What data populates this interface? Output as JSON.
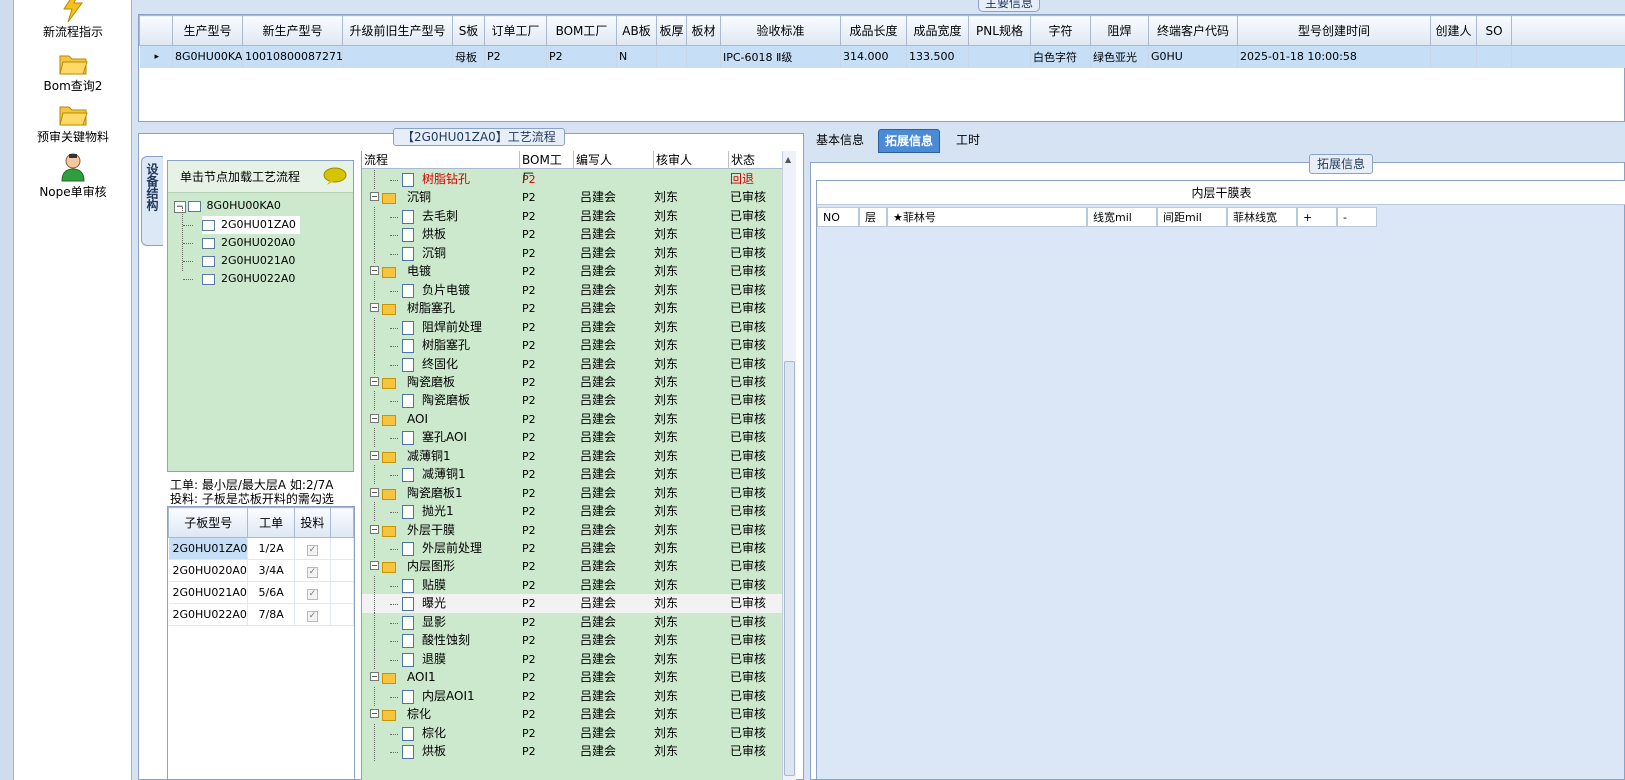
{
  "nav": {
    "items": [
      {
        "label": "新流程指示",
        "icon": "lightning-icon"
      },
      {
        "label": "Bom查询2",
        "icon": "folder-icon"
      },
      {
        "label": "预审关键物料",
        "icon": "folder-icon"
      },
      {
        "label": "Nope单审核",
        "icon": "user-icon"
      }
    ]
  },
  "main_info": {
    "title": "主要信息",
    "columns": [
      "生产型号",
      "新生产型号",
      "升级前旧生产型号",
      "S板",
      "订单工厂",
      "BOM工厂",
      "AB板",
      "板厚",
      "板材",
      "验收标准",
      "成品长度",
      "成品宽度",
      "PNL规格",
      "字符",
      "阻焊",
      "终端客户代码",
      "型号创建时间",
      "创建人",
      "SO"
    ],
    "row": [
      "8G0HU00KA0",
      "10010800087271",
      "",
      "母板",
      "P2",
      "P2",
      "N",
      "",
      "",
      "IPC-6018 Ⅱ级",
      "314.000",
      "133.500",
      "",
      "白色字符",
      "绿色亚光",
      "G0HU",
      "2025-01-18 10:00:58",
      "",
      ""
    ]
  },
  "process": {
    "title": "【2G0HU01ZA0】工艺流程",
    "vtab": "设备结构",
    "tree_header": "单击节点加载工艺流程",
    "tree": {
      "root": "8G0HU00KA0",
      "children": [
        "2G0HU01ZA0",
        "2G0HU020A0",
        "2G0HU021A0",
        "2G0HU022A0"
      ]
    },
    "info_line1": "工单: 最小层/最大层A 如:2/7A",
    "info_line2": "投料: 子板是芯板开料的需勾选",
    "sub_columns": [
      "子板型号",
      "工单",
      "投料"
    ],
    "sub_rows": [
      {
        "model": "2G0HU01ZA0",
        "order": "1/2A",
        "checked": true
      },
      {
        "model": "2G0HU020A0",
        "order": "3/4A",
        "checked": true
      },
      {
        "model": "2G0HU021A0",
        "order": "5/6A",
        "checked": true
      },
      {
        "model": "2G0HU022A0",
        "order": "7/8A",
        "checked": true
      }
    ],
    "flow_columns": [
      "流程",
      "BOM工厂",
      "编写人",
      "核审人",
      "状态"
    ],
    "flow_rows": [
      {
        "name": "树脂钻孔",
        "type": "doc",
        "level": 2,
        "bom": "P2",
        "writer": "",
        "reviewer": "",
        "status": "回退",
        "red": true
      },
      {
        "name": "沉铜",
        "type": "folder",
        "level": 1,
        "bom": "P2",
        "writer": "吕建会",
        "reviewer": "刘东",
        "status": "已审核"
      },
      {
        "name": "去毛刺",
        "type": "doc",
        "level": 2,
        "bom": "P2",
        "writer": "吕建会",
        "reviewer": "刘东",
        "status": "已审核"
      },
      {
        "name": "烘板",
        "type": "doc",
        "level": 2,
        "bom": "P2",
        "writer": "吕建会",
        "reviewer": "刘东",
        "status": "已审核"
      },
      {
        "name": "沉铜",
        "type": "doc",
        "level": 2,
        "bom": "P2",
        "writer": "吕建会",
        "reviewer": "刘东",
        "status": "已审核"
      },
      {
        "name": "电镀",
        "type": "folder",
        "level": 1,
        "bom": "P2",
        "writer": "吕建会",
        "reviewer": "刘东",
        "status": "已审核"
      },
      {
        "name": "负片电镀",
        "type": "doc",
        "level": 2,
        "bom": "P2",
        "writer": "吕建会",
        "reviewer": "刘东",
        "status": "已审核"
      },
      {
        "name": "树脂塞孔",
        "type": "folder",
        "level": 1,
        "bom": "P2",
        "writer": "吕建会",
        "reviewer": "刘东",
        "status": "已审核"
      },
      {
        "name": "阻焊前处理",
        "type": "doc",
        "level": 2,
        "bom": "P2",
        "writer": "吕建会",
        "reviewer": "刘东",
        "status": "已审核"
      },
      {
        "name": "树脂塞孔",
        "type": "doc",
        "level": 2,
        "bom": "P2",
        "writer": "吕建会",
        "reviewer": "刘东",
        "status": "已审核"
      },
      {
        "name": "终固化",
        "type": "doc",
        "level": 2,
        "bom": "P2",
        "writer": "吕建会",
        "reviewer": "刘东",
        "status": "已审核"
      },
      {
        "name": "陶瓷磨板",
        "type": "folder",
        "level": 1,
        "bom": "P2",
        "writer": "吕建会",
        "reviewer": "刘东",
        "status": "已审核"
      },
      {
        "name": "陶瓷磨板",
        "type": "doc",
        "level": 2,
        "bom": "P2",
        "writer": "吕建会",
        "reviewer": "刘东",
        "status": "已审核"
      },
      {
        "name": "AOI",
        "type": "folder",
        "level": 1,
        "bom": "P2",
        "writer": "吕建会",
        "reviewer": "刘东",
        "status": "已审核"
      },
      {
        "name": "塞孔AOI",
        "type": "doc",
        "level": 2,
        "bom": "P2",
        "writer": "吕建会",
        "reviewer": "刘东",
        "status": "已审核"
      },
      {
        "name": "减薄铜1",
        "type": "folder",
        "level": 1,
        "bom": "P2",
        "writer": "吕建会",
        "reviewer": "刘东",
        "status": "已审核"
      },
      {
        "name": "减薄铜1",
        "type": "doc",
        "level": 2,
        "bom": "P2",
        "writer": "吕建会",
        "reviewer": "刘东",
        "status": "已审核"
      },
      {
        "name": "陶瓷磨板1",
        "type": "folder",
        "level": 1,
        "bom": "P2",
        "writer": "吕建会",
        "reviewer": "刘东",
        "status": "已审核"
      },
      {
        "name": "抛光1",
        "type": "doc",
        "level": 2,
        "bom": "P2",
        "writer": "吕建会",
        "reviewer": "刘东",
        "status": "已审核"
      },
      {
        "name": "外层干膜",
        "type": "folder",
        "level": 1,
        "bom": "P2",
        "writer": "吕建会",
        "reviewer": "刘东",
        "status": "已审核"
      },
      {
        "name": "外层前处理",
        "type": "doc",
        "level": 2,
        "bom": "P2",
        "writer": "吕建会",
        "reviewer": "刘东",
        "status": "已审核"
      },
      {
        "name": "内层图形",
        "type": "folder",
        "level": 1,
        "bom": "P2",
        "writer": "吕建会",
        "reviewer": "刘东",
        "status": "已审核"
      },
      {
        "name": "贴膜",
        "type": "doc",
        "level": 2,
        "bom": "P2",
        "writer": "吕建会",
        "reviewer": "刘东",
        "status": "已审核"
      },
      {
        "name": "曝光",
        "type": "doc",
        "level": 2,
        "bom": "P2",
        "writer": "吕建会",
        "reviewer": "刘东",
        "status": "已审核",
        "selected": true
      },
      {
        "name": "显影",
        "type": "doc",
        "level": 2,
        "bom": "P2",
        "writer": "吕建会",
        "reviewer": "刘东",
        "status": "已审核"
      },
      {
        "name": "酸性蚀刻",
        "type": "doc",
        "level": 2,
        "bom": "P2",
        "writer": "吕建会",
        "reviewer": "刘东",
        "status": "已审核"
      },
      {
        "name": "退膜",
        "type": "doc",
        "level": 2,
        "bom": "P2",
        "writer": "吕建会",
        "reviewer": "刘东",
        "status": "已审核"
      },
      {
        "name": "AOI1",
        "type": "folder",
        "level": 1,
        "bom": "P2",
        "writer": "吕建会",
        "reviewer": "刘东",
        "status": "已审核"
      },
      {
        "name": "内层AOI1",
        "type": "doc",
        "level": 2,
        "bom": "P2",
        "writer": "吕建会",
        "reviewer": "刘东",
        "status": "已审核"
      },
      {
        "name": "棕化",
        "type": "folder",
        "level": 1,
        "bom": "P2",
        "writer": "吕建会",
        "reviewer": "刘东",
        "status": "已审核"
      },
      {
        "name": "棕化",
        "type": "doc",
        "level": 2,
        "bom": "P2",
        "writer": "吕建会",
        "reviewer": "刘东",
        "status": "已审核"
      },
      {
        "name": "烘板",
        "type": "doc",
        "level": 2,
        "bom": "P2",
        "writer": "吕建会",
        "reviewer": "刘东",
        "status": "已审核"
      }
    ]
  },
  "right": {
    "tabs": [
      "基本信息",
      "拓展信息",
      "工时"
    ],
    "active_tab": "拓展信息",
    "group_title": "拓展信息",
    "table_title": "内层干膜表",
    "columns": [
      "NO",
      "层",
      "★菲林号",
      "线宽mil",
      "间距mil",
      "菲林线宽",
      "+",
      "-"
    ]
  },
  "colors": {
    "selected_row": "#c7dff6",
    "tree_bg": "#cde9cd",
    "tab_active": "#4a8ad6",
    "status_red": "#d40000"
  }
}
